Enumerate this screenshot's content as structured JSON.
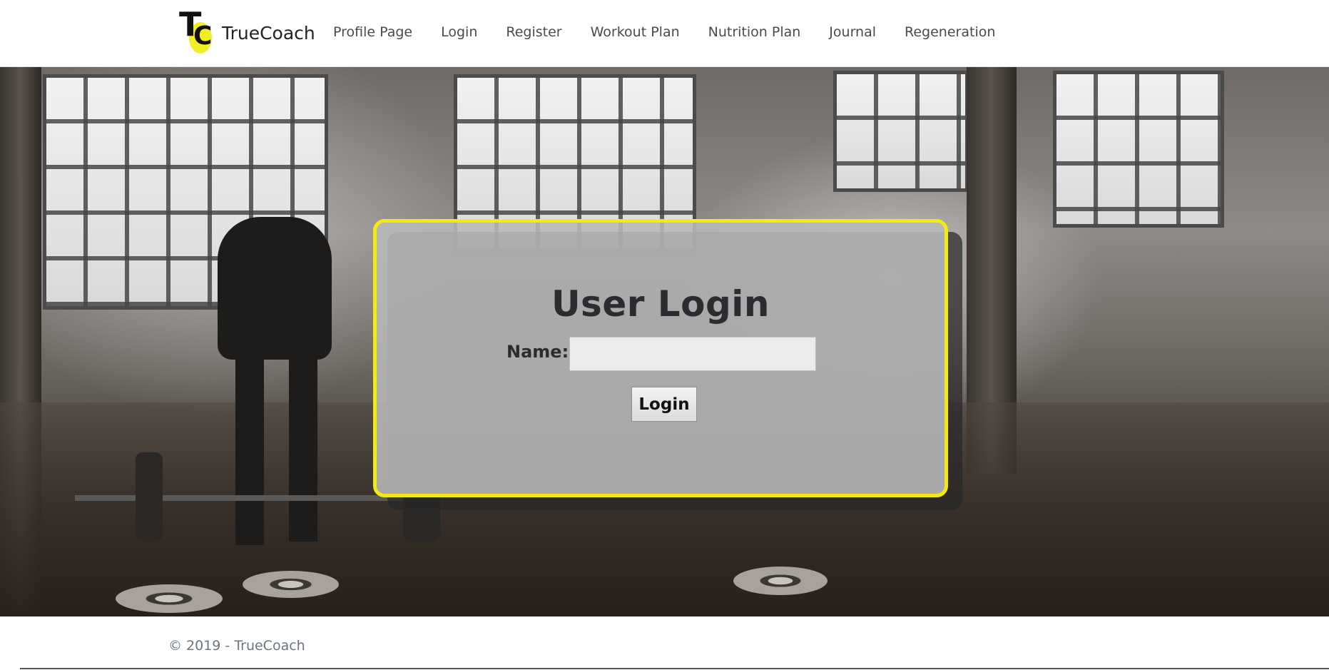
{
  "brand": {
    "logo_letters": "TC",
    "name": "TrueCoach",
    "accent_color": "#f2ea12"
  },
  "nav": {
    "items": [
      {
        "label": "Profile Page"
      },
      {
        "label": "Login"
      },
      {
        "label": "Register"
      },
      {
        "label": "Workout Plan"
      },
      {
        "label": "Nutrition Plan"
      },
      {
        "label": "Journal"
      },
      {
        "label": "Regeneration"
      }
    ]
  },
  "login": {
    "title": "User Login",
    "name_label": "Name:",
    "name_value": "",
    "name_placeholder": "",
    "submit_label": "Login"
  },
  "footer": {
    "text": "© 2019 - TrueCoach"
  }
}
